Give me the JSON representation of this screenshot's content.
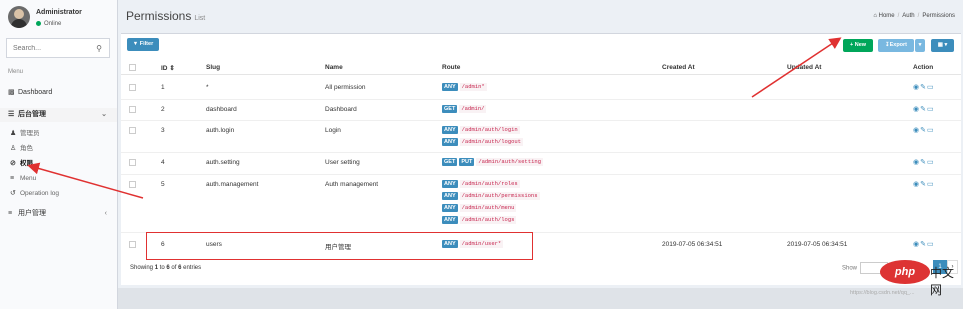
{
  "user": {
    "name": "Administrator",
    "status": "Online"
  },
  "search": {
    "placeholder": "Search..."
  },
  "menu": {
    "header": "Menu",
    "dashboard": "Dashboard",
    "admin_group": "后台管理",
    "admin_items": [
      {
        "label": "管理员",
        "icon": "users-icon"
      },
      {
        "label": "角色",
        "icon": "user-icon"
      },
      {
        "label": "权限",
        "icon": "ban-icon"
      },
      {
        "label": "Menu",
        "icon": "bars-icon"
      },
      {
        "label": "Operation log",
        "icon": "history-icon"
      }
    ],
    "user_mgmt": "用户管理"
  },
  "header": {
    "title": "Permissions",
    "subtitle": "List",
    "breadcrumb": [
      "Home",
      "Auth",
      "Permissions"
    ]
  },
  "toolbar": {
    "filter": "Filter",
    "new": "New",
    "export": "Export"
  },
  "table": {
    "columns": [
      "ID",
      "Slug",
      "Name",
      "Route",
      "Created At",
      "Updated At",
      "Action"
    ],
    "rows": [
      {
        "id": "1",
        "slug": "*",
        "name": "All permission",
        "routes": [
          {
            "verbs": [
              "ANY"
            ],
            "path": "/admin*"
          }
        ],
        "created": "",
        "updated": ""
      },
      {
        "id": "2",
        "slug": "dashboard",
        "name": "Dashboard",
        "routes": [
          {
            "verbs": [
              "GET"
            ],
            "path": "/admin/"
          }
        ],
        "created": "",
        "updated": ""
      },
      {
        "id": "3",
        "slug": "auth.login",
        "name": "Login",
        "routes": [
          {
            "verbs": [
              "ANY"
            ],
            "path": "/admin/auth/login"
          },
          {
            "verbs": [
              "ANY"
            ],
            "path": "/admin/auth/logout"
          }
        ],
        "created": "",
        "updated": ""
      },
      {
        "id": "4",
        "slug": "auth.setting",
        "name": "User setting",
        "routes": [
          {
            "verbs": [
              "GET",
              "PUT"
            ],
            "path": "/admin/auth/setting"
          }
        ],
        "created": "",
        "updated": ""
      },
      {
        "id": "5",
        "slug": "auth.management",
        "name": "Auth management",
        "routes": [
          {
            "verbs": [
              "ANY"
            ],
            "path": "/admin/auth/roles"
          },
          {
            "verbs": [
              "ANY"
            ],
            "path": "/admin/auth/permissions"
          },
          {
            "verbs": [
              "ANY"
            ],
            "path": "/admin/auth/menu"
          },
          {
            "verbs": [
              "ANY"
            ],
            "path": "/admin/auth/logs"
          }
        ],
        "created": "",
        "updated": ""
      },
      {
        "id": "6",
        "slug": "users",
        "name": "用户管理",
        "routes": [
          {
            "verbs": [
              "ANY"
            ],
            "path": "/admin/user*"
          }
        ],
        "created": "2019-07-05 06:34:51",
        "updated": "2019-07-05 06:34:51"
      }
    ]
  },
  "footer": {
    "showing": "Showing",
    "from": "1",
    "to_word": "to",
    "to": "6",
    "of_word": "of",
    "total": "6",
    "entries": "entries",
    "show": "Show",
    "entries_suffix": "entries",
    "page": "1"
  },
  "watermark": {
    "logo": "php",
    "text": "中文网",
    "url": "https://blog.csdn.net/qq_..."
  },
  "colors": {
    "primary": "#3c8dbc",
    "success": "#00a65a",
    "annotation": "#e03131"
  }
}
